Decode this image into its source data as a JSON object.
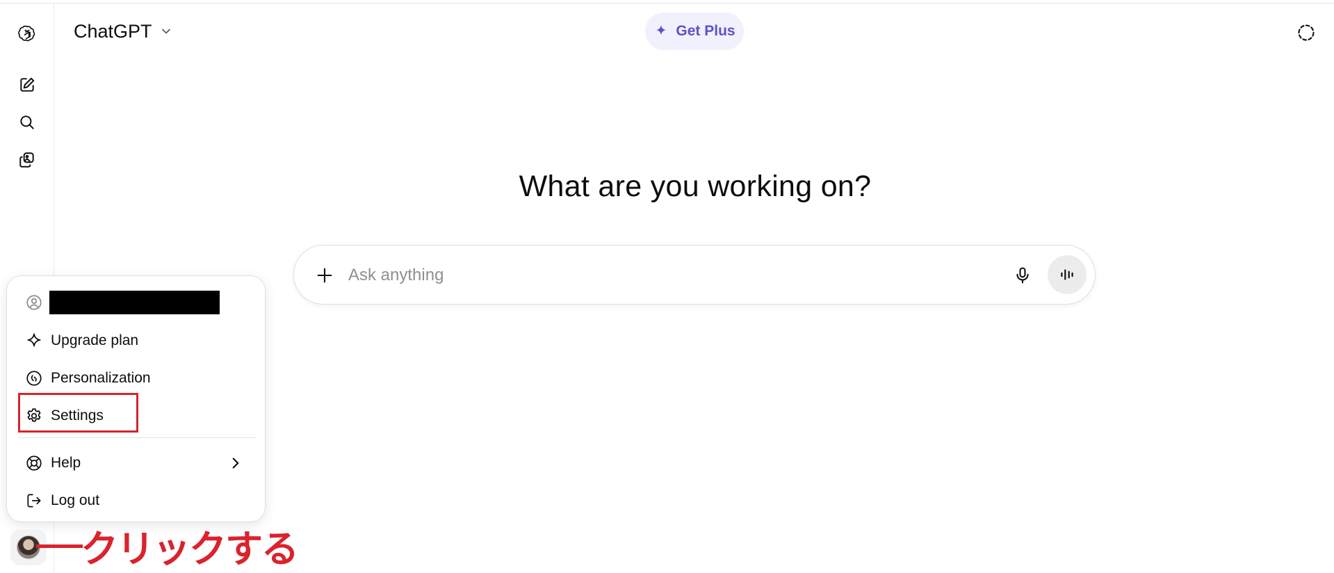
{
  "header": {
    "model_name": "ChatGPT",
    "get_plus_label": "Get Plus"
  },
  "main": {
    "title": "What are you working on?",
    "composer": {
      "placeholder": "Ask anything"
    }
  },
  "account_menu": {
    "email": "",
    "items": [
      {
        "label": "Upgrade plan",
        "icon": "sparkle-icon"
      },
      {
        "label": "Personalization",
        "icon": "personalization-icon"
      },
      {
        "label": "Settings",
        "icon": "gear-icon"
      },
      {
        "label": "Help",
        "icon": "lifebuoy-icon"
      },
      {
        "label": "Log out",
        "icon": "logout-icon"
      }
    ]
  },
  "annotation": {
    "text": "クリックする",
    "color": "#d9232d"
  },
  "colors": {
    "accent": "#5b53c7",
    "get_plus_bg": "#f1f0fd",
    "annotation_red": "#d9232d"
  }
}
